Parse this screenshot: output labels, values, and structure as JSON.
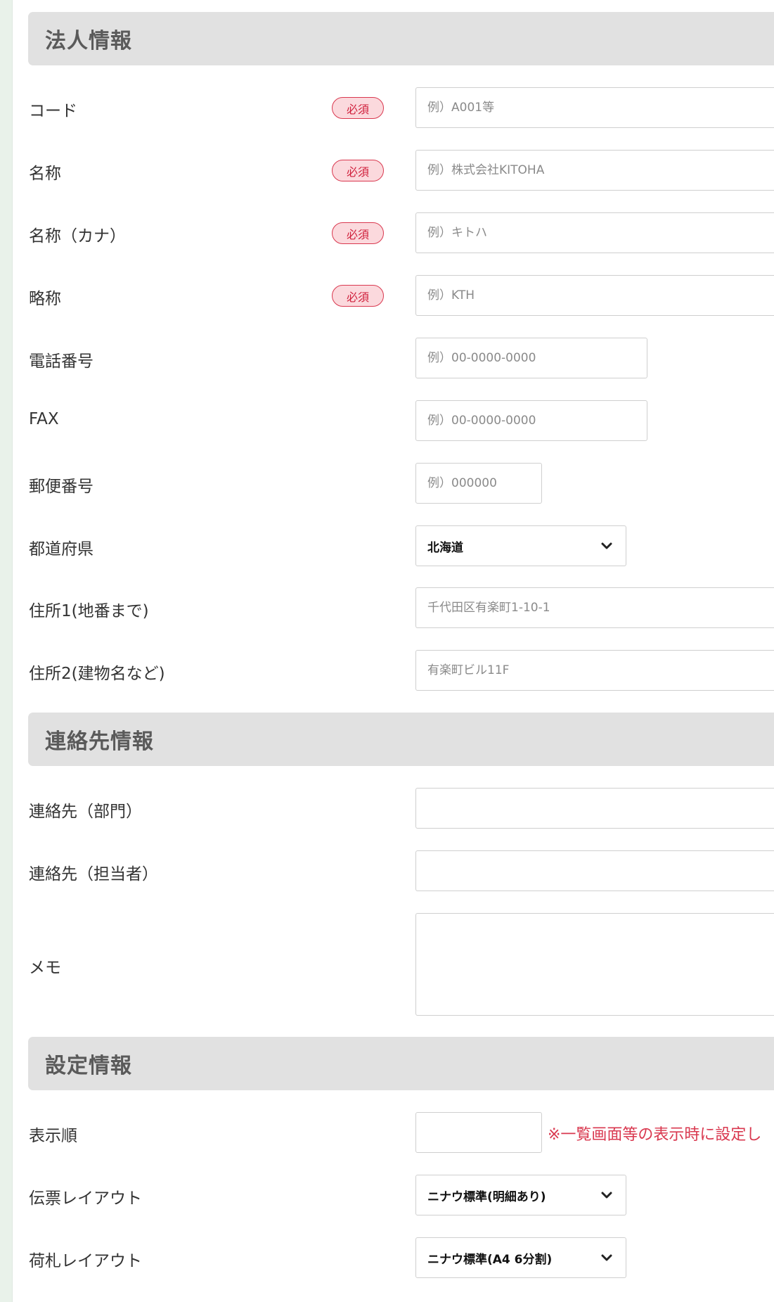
{
  "sections": {
    "corporate": "法人情報",
    "contact": "連絡先情報",
    "settings": "設定情報"
  },
  "required_badge": "必須",
  "corporate_fields": {
    "code": {
      "label": "コード",
      "placeholder": "例）A001等"
    },
    "name": {
      "label": "名称",
      "placeholder": "例）株式会社KITOHA"
    },
    "name_kana": {
      "label": "名称（カナ）",
      "placeholder": "例）キトハ"
    },
    "short_name": {
      "label": "略称",
      "placeholder": "例）KTH"
    },
    "phone": {
      "label": "電話番号",
      "placeholder": "例）00-0000-0000"
    },
    "fax": {
      "label": "FAX",
      "placeholder": "例）00-0000-0000"
    },
    "postal_code": {
      "label": "郵便番号",
      "placeholder": "例）000000"
    },
    "prefecture": {
      "label": "都道府県",
      "value": "北海道"
    },
    "address1": {
      "label": "住所1(地番まで)",
      "placeholder": "千代田区有楽町1-10-1"
    },
    "address2": {
      "label": "住所2(建物名など)",
      "placeholder": "有楽町ビル11F"
    }
  },
  "contact_fields": {
    "department": {
      "label": "連絡先（部門）"
    },
    "person": {
      "label": "連絡先（担当者）"
    },
    "memo": {
      "label": "メモ"
    }
  },
  "settings_fields": {
    "display_order": {
      "label": "表示順",
      "note": "※一覧画面等の表示時に設定し"
    },
    "slip_layout": {
      "label": "伝票レイアウト",
      "value": "ニナウ標準(明細あり)"
    },
    "tag_layout": {
      "label": "荷札レイアウト",
      "value": "ニナウ標準(A4 6分割)"
    }
  },
  "colors": {
    "section_bg": "#e1e1e1",
    "badge_bg": "#fbd9dd",
    "badge_border": "#d9384f",
    "note_text": "#d9384f",
    "left_rail": "#e9f2ea"
  },
  "icons": {
    "select_arrow": "chevron-down-icon"
  }
}
